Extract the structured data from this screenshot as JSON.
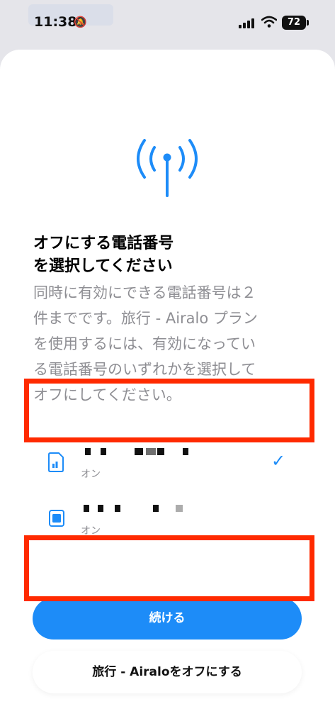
{
  "status_bar": {
    "time": "11:38",
    "battery": "72"
  },
  "sheet": {
    "title_line1": "オフにする電話番号",
    "title_line2": "を選択してください",
    "desc_line1": "同時に有効にできる電話番号は２",
    "desc_line2": "件までです。旅行 - Airalo プラン",
    "desc_line3": "を使用するには、有効になってい",
    "desc_line4": "る電話番号のいずれかを選択して",
    "desc_line5": "オフにしてください。"
  },
  "sims": [
    {
      "status": "オン",
      "selected": true,
      "icon": "sim-card-icon"
    },
    {
      "status": "オン",
      "selected": false,
      "icon": "esim-chip-icon"
    }
  ],
  "buttons": {
    "continue_label": "続ける",
    "turn_off_label": "旅行 - Airaloをオフにする"
  },
  "colors": {
    "accent": "#1d8cf8",
    "highlight": "#ff2a00"
  }
}
